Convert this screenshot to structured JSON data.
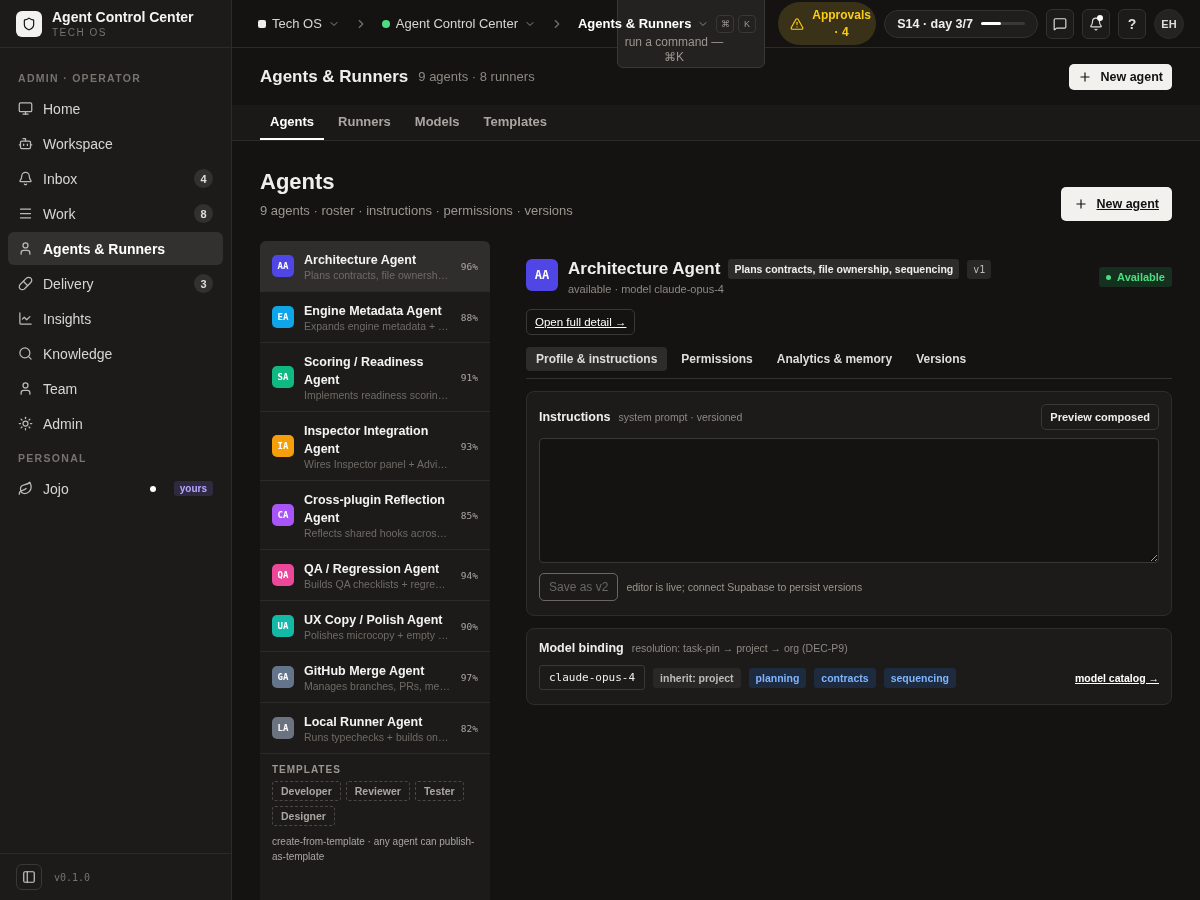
{
  "app": {
    "name": "Agent Control Center",
    "subtitle": "TECH OS"
  },
  "breadcrumbs": [
    {
      "label": "Tech OS",
      "kind": "square"
    },
    {
      "label": "Agent Control Center",
      "kind": "dot"
    },
    {
      "label": "Agents & Runners",
      "kind": "current"
    }
  ],
  "command_tooltip": {
    "text": "run a command — ⌘K",
    "keys": [
      "⌘",
      "K"
    ]
  },
  "approvals": {
    "label": "Approvals · 4"
  },
  "sprint": {
    "label": "S14 · day 3/7",
    "level": 0.45
  },
  "notifications": {
    "unread": true
  },
  "help": "?",
  "user_avatar": "EH",
  "sidebar": {
    "sections": [
      {
        "heading": "ADMIN · OPERATOR",
        "items": [
          {
            "label": "Home",
            "kind": "monitor",
            "selected": false
          },
          {
            "label": "Workspace",
            "kind": "bot",
            "selected": false
          },
          {
            "label": "Inbox",
            "kind": "bell",
            "badge": "4",
            "selected": false
          },
          {
            "label": "Work",
            "kind": "menu",
            "badge": "8",
            "selected": false
          },
          {
            "label": "Agents & Runners",
            "kind": "user",
            "selected": true
          },
          {
            "label": "Delivery",
            "kind": "pill",
            "badge": "3",
            "selected": false
          },
          {
            "label": "Insights",
            "kind": "chart",
            "selected": false
          },
          {
            "label": "Knowledge",
            "kind": "search",
            "selected": false
          },
          {
            "label": "Team",
            "kind": "user",
            "selected": false
          },
          {
            "label": "Admin",
            "kind": "sun",
            "selected": false
          }
        ]
      },
      {
        "heading": "PERSONAL",
        "items": [
          {
            "label": "Jojo",
            "kind": "leaf",
            "tag": "yours",
            "dot": true,
            "selected": false
          }
        ]
      }
    ],
    "version": "v0.1.0"
  },
  "page": {
    "title": "Agents & Runners",
    "meta": "9 agents · 8 runners",
    "new_button": "New agent"
  },
  "tabs": [
    {
      "label": "Agents",
      "selected": true
    },
    {
      "label": "Runners",
      "selected": false
    },
    {
      "label": "Models",
      "selected": false
    },
    {
      "label": "Templates",
      "selected": false
    }
  ],
  "agents_section": {
    "title": "Agents",
    "subtitle": "9 agents · roster · instructions · permissions · versions",
    "new_button": "New agent"
  },
  "agents": [
    {
      "initials": "AA",
      "name": "Architecture Agent",
      "description": "Plans contracts, file ownersh…",
      "score": "96%",
      "color": "#4f46e5",
      "selected": true
    },
    {
      "initials": "EA",
      "name": "Engine Metadata Agent",
      "description": "Expands engine metadata + …",
      "score": "88%",
      "color": "#0ea5e9",
      "selected": false
    },
    {
      "initials": "SA",
      "name": "Scoring / Readiness Agent",
      "description": "Implements readiness scorin…",
      "score": "91%",
      "color": "#10b981",
      "selected": false
    },
    {
      "initials": "IA",
      "name": "Inspector Integration Agent",
      "description": "Wires Inspector panel + Advi…",
      "score": "93%",
      "color": "#f59e0b",
      "selected": false
    },
    {
      "initials": "CA",
      "name": "Cross-plugin Reflection Agent",
      "description": "Reflects shared hooks acros…",
      "score": "85%",
      "color": "#a855f7",
      "selected": false
    },
    {
      "initials": "QA",
      "name": "QA / Regression Agent",
      "description": "Builds QA checklists + regre…",
      "score": "94%",
      "color": "#ec4899",
      "selected": false
    },
    {
      "initials": "UA",
      "name": "UX Copy / Polish Agent",
      "description": "Polishes microcopy + empty …",
      "score": "90%",
      "color": "#14b8a6",
      "selected": false
    },
    {
      "initials": "GA",
      "name": "GitHub Merge Agent",
      "description": "Manages branches, PRs, me…",
      "score": "97%",
      "color": "#64748b",
      "selected": false
    },
    {
      "initials": "LA",
      "name": "Local Runner Agent",
      "description": "Runs typechecks + builds on…",
      "score": "82%",
      "color": "#6b7280",
      "selected": false
    }
  ],
  "templates": {
    "heading": "TEMPLATES",
    "chips": [
      "Developer",
      "Reviewer",
      "Tester",
      "Designer"
    ],
    "note": "create-from-template · any agent can publish-as-template"
  },
  "detail": {
    "initials": "AA",
    "color": "#4f46e5",
    "name": "Architecture Agent",
    "tag": "Plans contracts, file ownership, sequencing",
    "version": "v1",
    "meta": "available · model claude-opus-4",
    "status": "Available",
    "open_link": "Open full detail →",
    "tabs": [
      {
        "label": "Profile & instructions",
        "selected": true
      },
      {
        "label": "Permissions",
        "selected": false
      },
      {
        "label": "Analytics & memory",
        "selected": false
      },
      {
        "label": "Versions",
        "selected": false
      }
    ],
    "instructions": {
      "title": "Instructions",
      "meta": "system prompt · versioned",
      "preview_button": "Preview composed",
      "save_button": "Save as v2",
      "save_disabled": true,
      "note": "editor is live; connect Supabase to persist versions"
    },
    "model_binding": {
      "title": "Model binding",
      "meta": "resolution: task-pin → project → org (DEC-P9)",
      "model": "claude-opus-4",
      "tags": [
        {
          "label": "inherit: project",
          "kind": "neutral"
        },
        {
          "label": "planning",
          "kind": "blue"
        },
        {
          "label": "contracts",
          "kind": "blue"
        },
        {
          "label": "sequencing",
          "kind": "blue"
        }
      ],
      "catalog_link": "model catalog →"
    }
  }
}
